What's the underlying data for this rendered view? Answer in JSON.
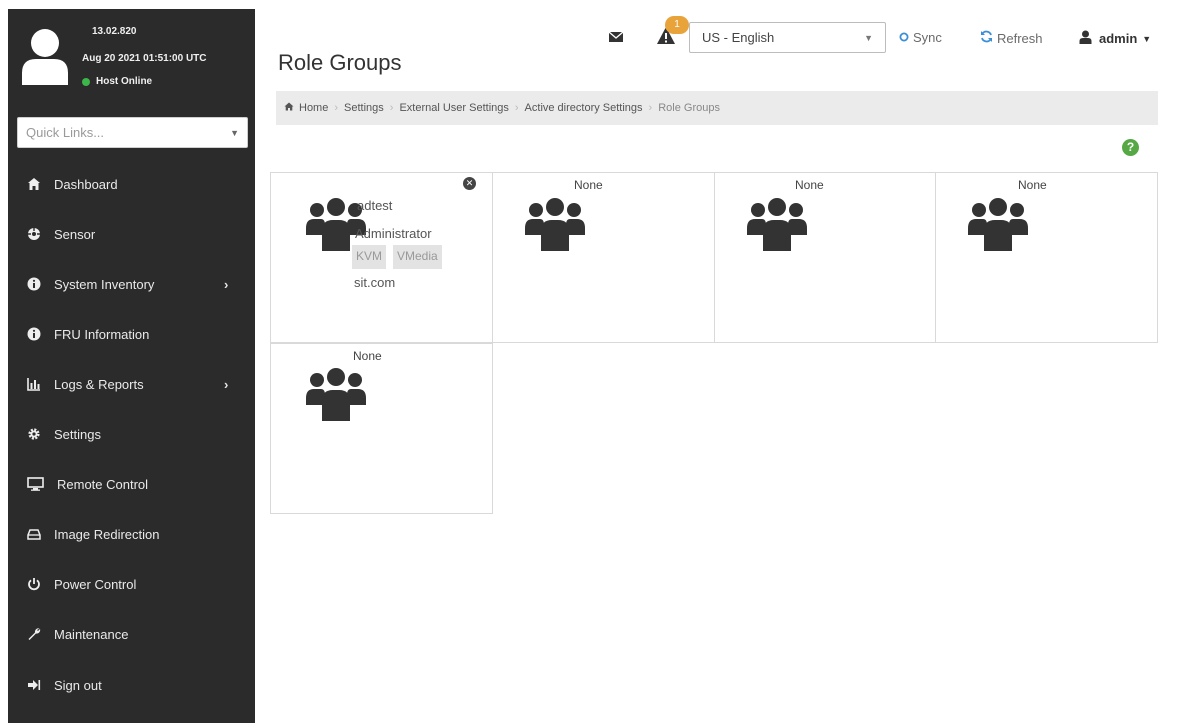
{
  "sidebar": {
    "fw_version": "13.02.820",
    "build_date": "Aug 20 2021 01:51:00 UTC",
    "host_status": "Host Online",
    "quick_links_placeholder": "Quick Links...",
    "items": [
      {
        "label": "Dashboard",
        "icon": "dashboard-icon"
      },
      {
        "label": "Sensor",
        "icon": "sensor-icon"
      },
      {
        "label": "System Inventory",
        "icon": "info-icon",
        "submenu": true
      },
      {
        "label": "FRU Information",
        "icon": "info-icon"
      },
      {
        "label": "Logs & Reports",
        "icon": "bar-chart-icon",
        "submenu": true
      },
      {
        "label": "Settings",
        "icon": "gear-icon"
      },
      {
        "label": "Remote Control",
        "icon": "monitor-icon"
      },
      {
        "label": "Image Redirection",
        "icon": "drive-icon"
      },
      {
        "label": "Power Control",
        "icon": "power-icon"
      },
      {
        "label": "Maintenance",
        "icon": "wrench-icon"
      },
      {
        "label": "Sign out",
        "icon": "sign-out-icon"
      }
    ]
  },
  "header": {
    "title": "Role Groups",
    "alert_count": "1",
    "language": "US - English",
    "sync_label": "Sync",
    "refresh_label": "Refresh",
    "user_label": "admin"
  },
  "breadcrumb": [
    "Home",
    "Settings",
    "External User Settings",
    "Active directory Settings",
    "Role Groups"
  ],
  "role_groups": [
    {
      "name": "adtest",
      "privilege": "Administrator",
      "tags": [
        "KVM",
        "VMedia"
      ],
      "domain": "sit.com"
    },
    {
      "name": "None"
    },
    {
      "name": "None"
    },
    {
      "name": "None"
    },
    {
      "name": "None"
    }
  ],
  "colors": {
    "sidebar_bg": "#2b2b2b",
    "status_online": "#3cb54a",
    "alert_badge": "#e8a33a",
    "help": "#56a845",
    "link_blue": "#3a8fd6"
  }
}
